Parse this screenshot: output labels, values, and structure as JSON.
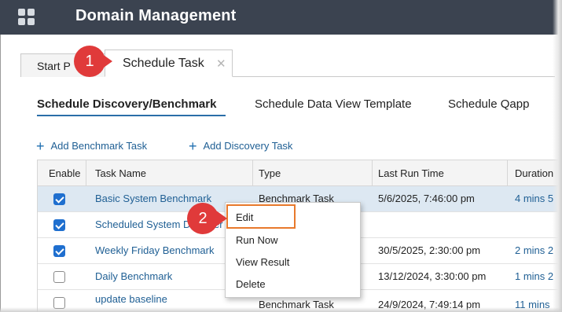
{
  "app": {
    "title": "Domain Management",
    "icon": "grid-apps-icon"
  },
  "tabs": [
    {
      "label": "Start P",
      "active": false
    },
    {
      "label": "Schedule Task",
      "active": true,
      "close_glyph": "✕"
    }
  ],
  "callouts": [
    "1",
    "2"
  ],
  "subtabs": [
    {
      "label": "Schedule Discovery/Benchmark",
      "active": true
    },
    {
      "label": "Schedule Data View Template",
      "active": false
    },
    {
      "label": "Schedule Qapp",
      "active": false
    }
  ],
  "actions": [
    {
      "label": "Add Benchmark Task",
      "icon": "plus-icon"
    },
    {
      "label": "Add Discovery Task",
      "icon": "plus-icon"
    }
  ],
  "table": {
    "columns": [
      "Enable",
      "Task Name",
      "Type",
      "Last Run Time",
      "Duration"
    ],
    "rows": [
      {
        "enabled": true,
        "name": "Basic System Benchmark",
        "type": "Benchmark Task",
        "last_run": "5/6/2025, 7:46:00 pm",
        "duration": "4 mins 5",
        "selected": true
      },
      {
        "enabled": true,
        "name": "Scheduled System Discover",
        "type": "",
        "last_run": "",
        "duration": ""
      },
      {
        "enabled": true,
        "name": "Weekly Friday Benchmark",
        "type": "",
        "last_run": "30/5/2025, 2:30:00 pm",
        "duration": "2 mins 2"
      },
      {
        "enabled": false,
        "name": "Daily Benchmark",
        "type": "",
        "last_run": "13/12/2024, 3:30:00 pm",
        "duration": "1 mins 2"
      },
      {
        "enabled": false,
        "name": "update baseline",
        "type": "Benchmark Task",
        "last_run": "24/9/2024, 7:49:14 pm",
        "duration": "11 mins"
      }
    ]
  },
  "context_menu": {
    "items": [
      "Edit",
      "Run Now",
      "View Result",
      "Delete"
    ],
    "highlighted": "Edit"
  },
  "colors": {
    "appbar": "#3b4350",
    "link": "#1f5f94",
    "callout": "#e03a3a",
    "highlight_border": "#e8792c",
    "selected_row": "#dde8f2"
  }
}
